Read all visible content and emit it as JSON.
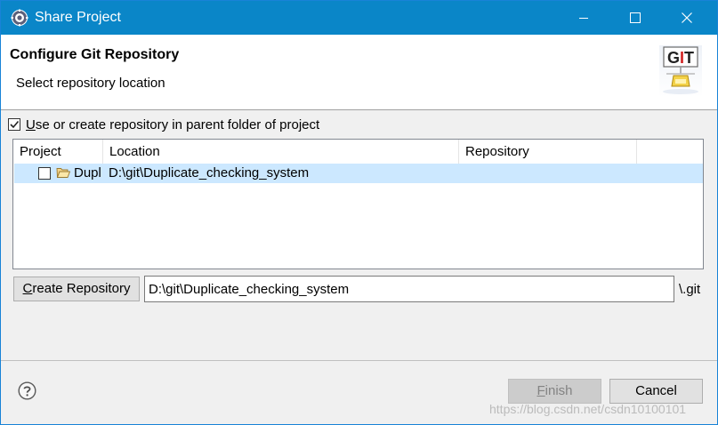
{
  "window": {
    "title": "Share Project",
    "icon": "eclipse-gear-icon",
    "controls": [
      "minimize-icon",
      "maximize-icon",
      "close-icon"
    ]
  },
  "banner": {
    "title": "Configure Git Repository",
    "subtitle": "Select repository location",
    "logo_text": "GIT"
  },
  "options": {
    "use_parent_prefix": "U",
    "use_parent_rest": "se or create repository in parent folder of project",
    "use_parent_checked": true
  },
  "table": {
    "columns": [
      "Project",
      "Location",
      "Repository"
    ],
    "rows": [
      {
        "checked": false,
        "icon": "open-folder-icon",
        "project": "Dupl",
        "location": "D:\\git\\Duplicate_checking_system",
        "repository": ""
      }
    ]
  },
  "create": {
    "button_prefix": "C",
    "button_rest": "reate Repository",
    "path_value": "D:\\git\\Duplicate_checking_system",
    "suffix": "\\.git"
  },
  "footer": {
    "help_icon": "question-icon",
    "finish_prefix": "F",
    "finish_rest": "inish",
    "finish_enabled": false,
    "cancel_label": "Cancel"
  },
  "watermark": "https://blog.csdn.net/csdn10100101",
  "colors": {
    "titlebar": "#0a86c8",
    "row_selected": "#cce8ff",
    "button_face": "#e1e1e1"
  }
}
